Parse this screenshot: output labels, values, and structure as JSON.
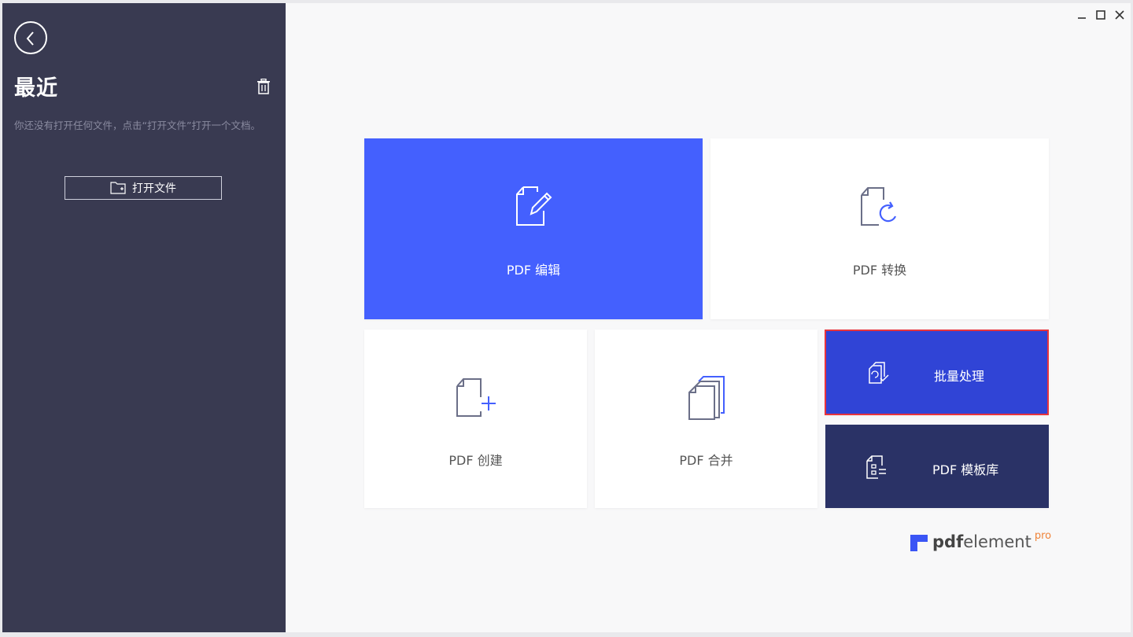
{
  "sidebar": {
    "title": "最近",
    "empty_message": "你还没有打开任何文件，点击“打开文件”打开一个文档。",
    "open_file_label": "打开文件"
  },
  "tiles": {
    "edit": "PDF 编辑",
    "convert": "PDF 转换",
    "create": "PDF 创建",
    "merge": "PDF 合并",
    "batch": "批量处理",
    "template": "PDF 模板库"
  },
  "brand": {
    "bold": "pdf",
    "rest": "element",
    "suffix": "pro"
  },
  "colors": {
    "sidebar_bg": "#393a51",
    "accent_blue": "#4460fe",
    "batch_blue": "#3044d6",
    "template_navy": "#2a3266",
    "selection_red": "#e8333c",
    "pro_orange": "#f0843a"
  },
  "icons": {
    "back": "chevron-left-icon",
    "trash": "trash-icon",
    "folder": "folder-open-icon",
    "edit": "document-pencil-icon",
    "convert": "document-refresh-icon",
    "create": "document-plus-icon",
    "merge": "documents-stack-icon",
    "batch": "documents-check-icon",
    "template": "document-template-icon"
  }
}
